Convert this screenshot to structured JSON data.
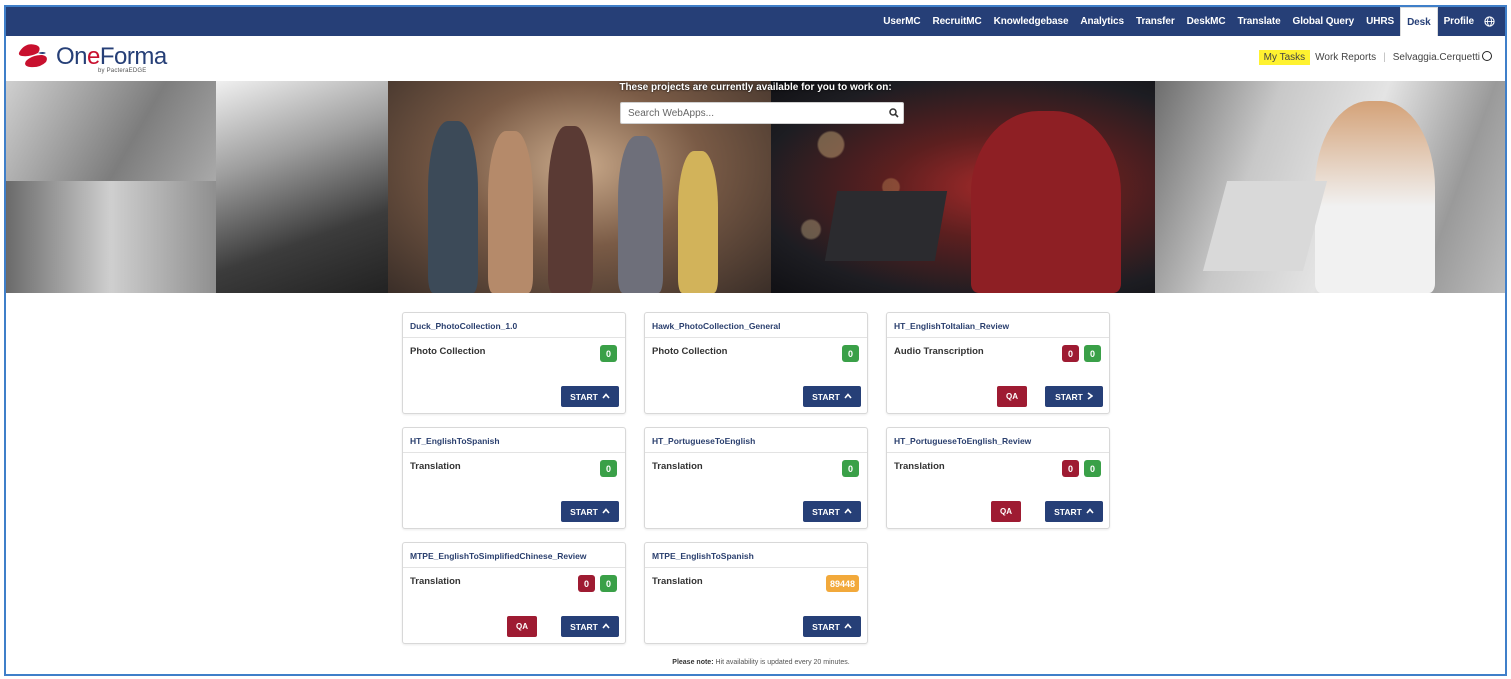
{
  "nav": {
    "items": [
      "UserMC",
      "RecruitMC",
      "Knowledgebase",
      "Analytics",
      "Transfer",
      "DeskMC",
      "Translate",
      "Global Query",
      "UHRS",
      "Desk",
      "Profile"
    ],
    "active": "Desk",
    "globe_icon": "globe-icon"
  },
  "logo": {
    "brand_part1": "On",
    "brand_e": "e",
    "brand_part2": "Forma",
    "sub": "by PacteraEDGE",
    "mark_colors": [
      "#c8102e",
      "#263f77"
    ]
  },
  "header": {
    "my_tasks": "My Tasks",
    "work_reports": "Work Reports",
    "user": "Selvaggia.Cerquetti"
  },
  "hero": {
    "text": "These projects are currently available for you to work on:",
    "search_placeholder": "Search WebApps..."
  },
  "cards": [
    {
      "title": "Duck_PhotoCollection_1.0",
      "type": "Photo Collection",
      "badges": [
        {
          "value": "0",
          "color": "green"
        }
      ],
      "qa": false,
      "start": "START",
      "chevron": "up"
    },
    {
      "title": "Hawk_PhotoCollection_General",
      "type": "Photo Collection",
      "badges": [
        {
          "value": "0",
          "color": "green"
        }
      ],
      "qa": false,
      "start": "START",
      "chevron": "up"
    },
    {
      "title": "HT_EnglishToItalian_Review",
      "type": "Audio Transcription",
      "badges": [
        {
          "value": "0",
          "color": "red"
        },
        {
          "value": "0",
          "color": "green"
        }
      ],
      "qa": true,
      "qa_label": "QA",
      "start": "START",
      "chevron": "right"
    },
    {
      "title": "HT_EnglishToSpanish",
      "type": "Translation",
      "badges": [
        {
          "value": "0",
          "color": "green"
        }
      ],
      "qa": false,
      "start": "START",
      "chevron": "up"
    },
    {
      "title": "HT_PortugueseToEnglish",
      "type": "Translation",
      "badges": [
        {
          "value": "0",
          "color": "green"
        }
      ],
      "qa": false,
      "start": "START",
      "chevron": "up"
    },
    {
      "title": "HT_PortugueseToEnglish_Review",
      "type": "Translation",
      "badges": [
        {
          "value": "0",
          "color": "red"
        },
        {
          "value": "0",
          "color": "green"
        }
      ],
      "qa": true,
      "qa_label": "QA",
      "start": "START",
      "chevron": "up"
    },
    {
      "title": "MTPE_EnglishToSimplifiedChinese_Review",
      "type": "Translation",
      "badges": [
        {
          "value": "0",
          "color": "red"
        },
        {
          "value": "0",
          "color": "green"
        }
      ],
      "qa": true,
      "qa_label": "QA",
      "start": "START",
      "chevron": "up"
    },
    {
      "title": "MTPE_EnglishToSpanish",
      "type": "Translation",
      "badges": [
        {
          "value": "89448",
          "color": "orange"
        }
      ],
      "qa": false,
      "start": "START",
      "chevron": "up"
    }
  ],
  "note": {
    "bold": "Please note:",
    "text": " Hit availability is updated every 20 minutes."
  },
  "colors": {
    "nav_bg": "#263f77",
    "start_btn": "#263f77",
    "qa_btn": "#9e1b32",
    "badge_green": "#3aa048",
    "badge_red": "#9e1b32",
    "badge_orange": "#f2a93b",
    "highlight": "#fff230"
  }
}
